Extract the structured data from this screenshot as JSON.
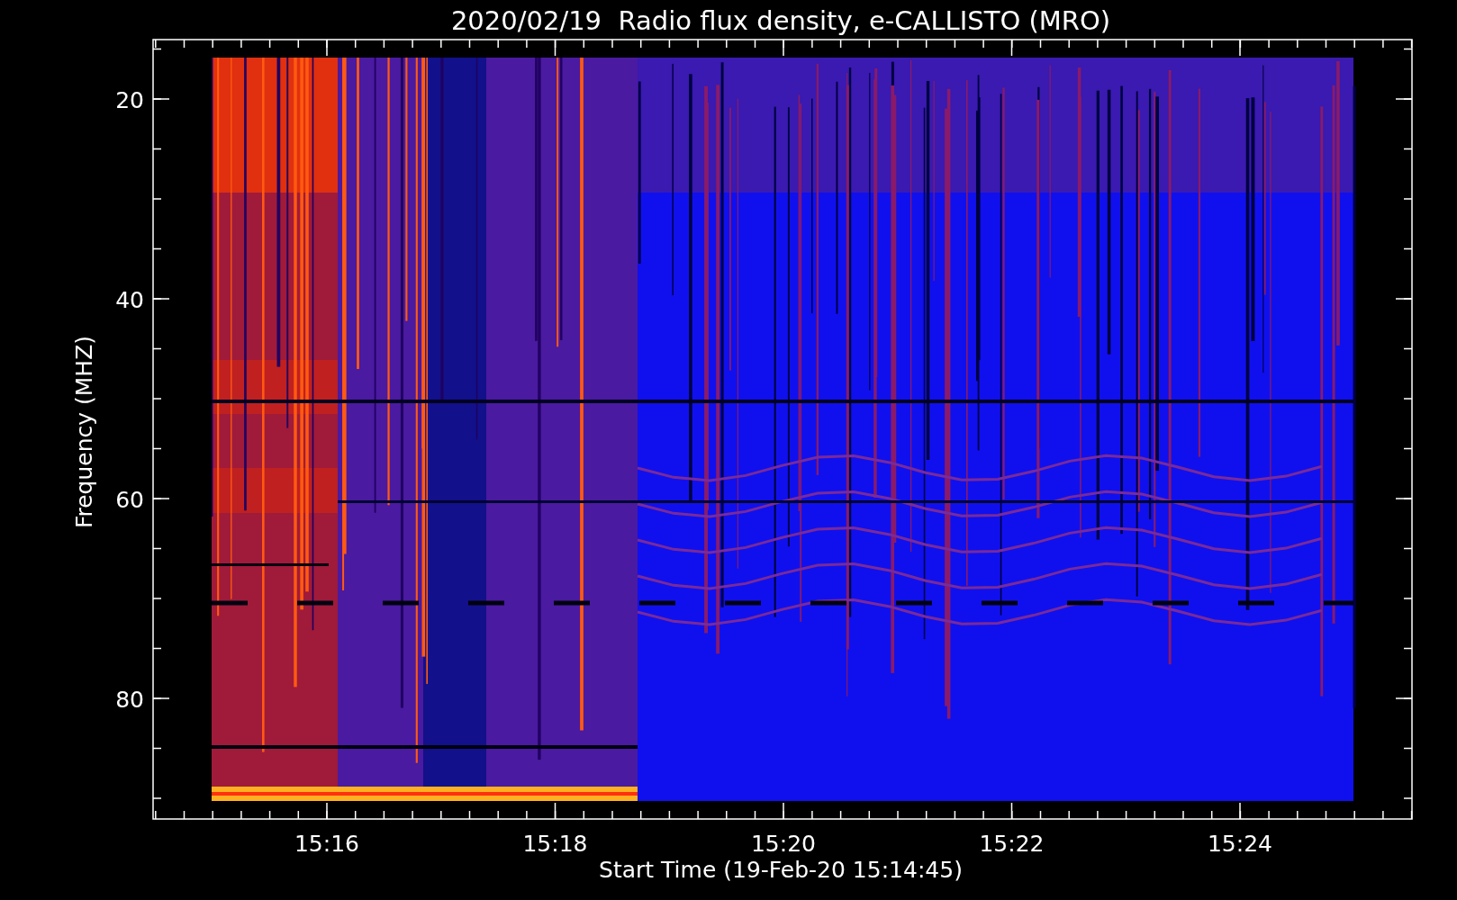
{
  "title": "2020/02/19  Radio flux density, e-CALLISTO (MRO)",
  "y_axis": {
    "label": "Frequency (MHZ)",
    "ticks": [
      "20",
      "40",
      "60",
      "80"
    ]
  },
  "x_axis": {
    "label": "Start Time (19-Feb-20 15:14:45)",
    "ticks": [
      "15:16",
      "15:18",
      "15:20",
      "15:22",
      "15:24"
    ]
  }
}
